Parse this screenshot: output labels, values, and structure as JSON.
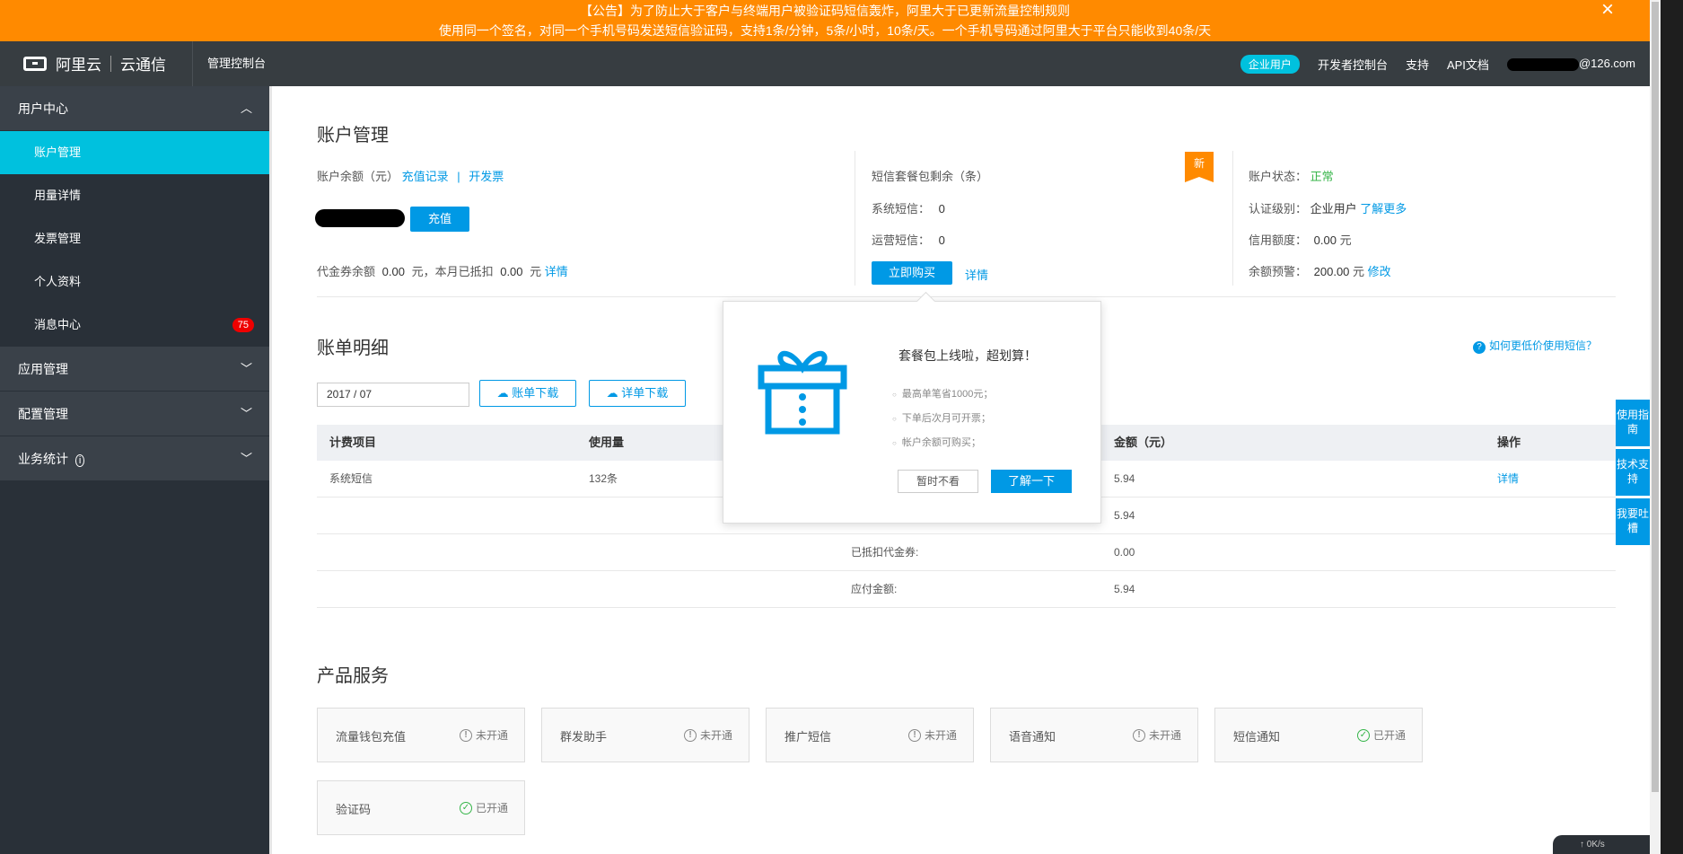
{
  "announcement": {
    "line1": "【公告】为了防止大于客户与终端用户被验证码短信轰炸，阿里大于已更新流量控制规则",
    "line2": "使用同一个签名，对同一个手机号码发送短信验证码，支持1条/分钟，5条/小时，10条/天。一个手机号码通过阿里大于平台只能收到40条/天",
    "close": "×"
  },
  "topbar": {
    "logo": "阿里云",
    "product": "云通信",
    "console": "管理控制台",
    "enterprise_badge": "企业用户",
    "dev_console": "开发者控制台",
    "support": "支持",
    "api_docs": "API文档",
    "user_suffix": "@126.com"
  },
  "sidebar": {
    "group1": "用户中心",
    "items": [
      "账户管理",
      "用量详情",
      "发票管理",
      "个人资料",
      "消息中心"
    ],
    "msg_count": "75",
    "group2": "应用管理",
    "group3": "配置管理",
    "group4": "业务统计"
  },
  "account": {
    "title": "账户管理",
    "balance_label": "账户余额（元）",
    "recharge_record": "充值记录",
    "divider": "|",
    "invoice": "开发票",
    "recharge_btn": "充值",
    "coupon_label": "代金券余额",
    "coupon_value": "0.00",
    "coupon_mid": "元，本月已抵扣",
    "deducted_value": "0.00",
    "yuan": "元",
    "details": "详情",
    "package_label": "短信套餐包剩余（条）",
    "new_tag": "新",
    "sys_sms_label": "系统短信：",
    "sys_sms_value": "0",
    "ops_sms_label": "运营短信：",
    "ops_sms_value": "0",
    "buy_btn": "立即购买",
    "status_label": "账户状态：",
    "status_value": "正常",
    "cert_label": "认证级别：",
    "cert_value": "企业用户",
    "learn_more": "了解更多",
    "credit_label": "信用额度：",
    "credit_value": "0.00",
    "alert_label": "余额预警：",
    "alert_value": "200.00",
    "modify": "修改"
  },
  "bill": {
    "title": "账单明细",
    "help_link": "如何更低价使用短信？",
    "date": "2017 / 07",
    "download_bill": "账单下载",
    "download_detail": "详单下载",
    "headers": [
      "计费项目",
      "使用量",
      "金额（元）",
      "操作"
    ],
    "row1": {
      "item": "系统短信",
      "usage": "132条",
      "amount": "5.94",
      "action": "详情"
    },
    "total_amount": "5.94",
    "coupon_label": "已抵扣代金券:",
    "coupon_value": "0.00",
    "payable_label": "应付金额:",
    "payable_value": "5.94"
  },
  "popup": {
    "title": "套餐包上线啦，超划算！",
    "points": [
      "最高单笔省1000元；",
      "下单后次月可开票；",
      "帐户余额可购买；"
    ],
    "dismiss": "暂时不看",
    "learn": "了解一下"
  },
  "products": {
    "title": "产品服务",
    "items": [
      {
        "name": "流量钱包充值",
        "status": "未开通"
      },
      {
        "name": "群发助手",
        "status": "未开通"
      },
      {
        "name": "推广短信",
        "status": "未开通"
      },
      {
        "name": "语音通知",
        "status": "未开通"
      },
      {
        "name": "短信通知",
        "status": "已开通"
      },
      {
        "name": "验证码",
        "status": "已开通"
      }
    ]
  },
  "float_buttons": [
    "使用指南",
    "技术支持",
    "我要吐槽"
  ],
  "net_speed": "0K/s"
}
